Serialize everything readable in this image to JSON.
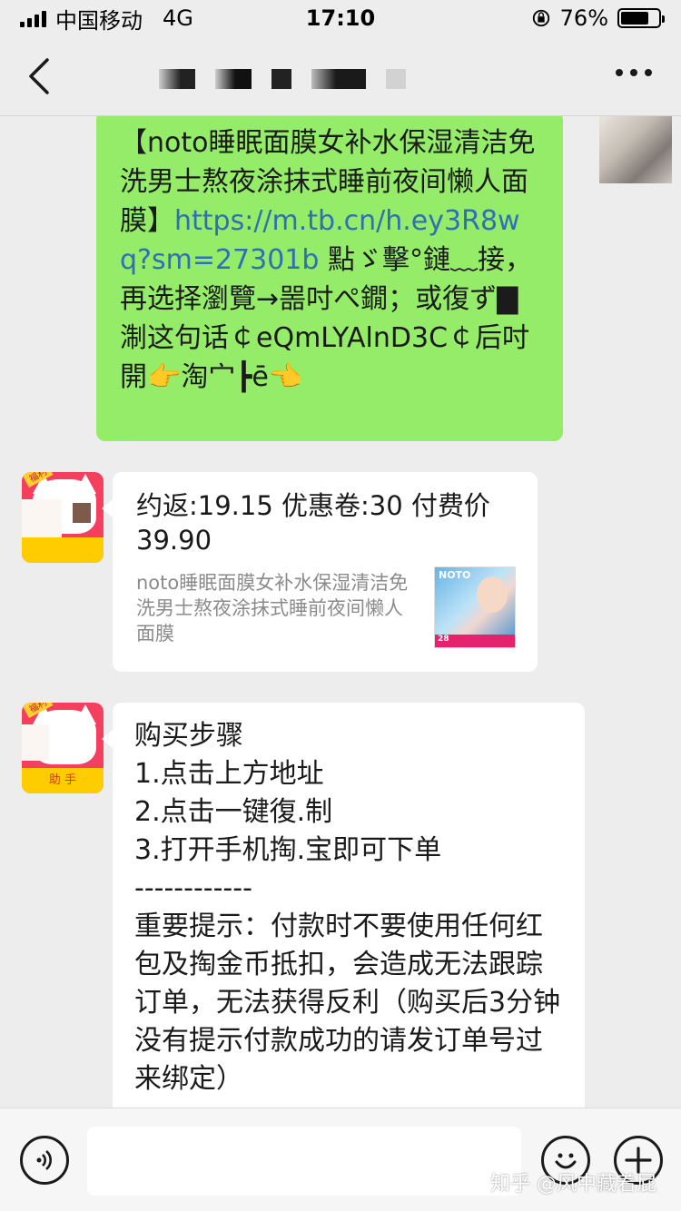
{
  "status_bar": {
    "carrier": "中国移动",
    "network": "4G",
    "time": "17:10",
    "battery": "76%",
    "battery_level": 0.76
  },
  "nav": {
    "back_icon": "chevron-left-icon",
    "more_icon": "more-dots-icon"
  },
  "messages": {
    "sent_taobao_text_1": "【noto睡眠面膜女补水保湿清洁免洗男士熬夜涂抹式睡前夜间懒人面膜】",
    "sent_taobao_link": "https://m.tb.cn/h.ey3R8wq?sm=27301b",
    "sent_taobao_text_2": " 點ゞ擊°鏈﹏接，再选择瀏覽→噐吋ぺ鐗；或復ず▇淛这句话￠eQmLYAlnD3C￠后吋開👉淘宀┣ē👈",
    "card_title": "约返:19.15 优惠卷:30 付费价39.90",
    "card_desc": "noto睡眠面膜女补水保湿清洁免洗男士熬夜涂抹式睡前夜间懒人面膜",
    "card_thumb_brand": "NOTO",
    "card_thumb_badge": "28",
    "steps_title": "购买步骤",
    "steps_1": "1.点击上方地址",
    "steps_2": "2.点击一键復.制",
    "steps_3": "3.打开手机掏.宝即可下单",
    "steps_divider": "------------",
    "steps_note": "重要提示：付款时不要使用任何红包及掏金币抵扣，会造成无法跟踪订单，无法获得反利（购买后3分钟没有提示付款成功的请发订单号过来绑定）"
  },
  "avatar": {
    "badge": "福利",
    "foot": "助 手"
  },
  "input_bar": {
    "voice_icon": "voice-icon",
    "emoji_icon": "emoji-icon",
    "plus_icon": "plus-icon",
    "placeholder": ""
  },
  "watermark": "知乎 @风中藏着屁"
}
